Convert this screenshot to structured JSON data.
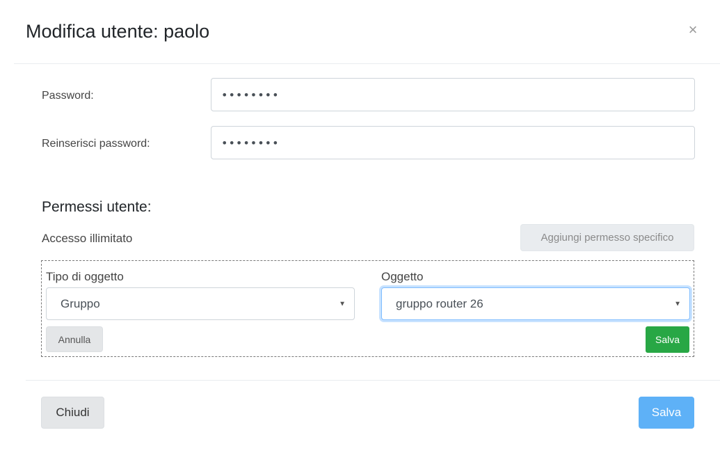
{
  "modal": {
    "title": "Modifica utente: paolo",
    "close_label": "×"
  },
  "form": {
    "password_label": "Password:",
    "password_value": "••••••••",
    "confirm_label": "Reinserisci password:",
    "confirm_value": "••••••••"
  },
  "permissions": {
    "title": "Permessi utente:",
    "access_text": "Accesso illimitato",
    "add_button": "Aggiungi permesso specifico",
    "object_type_label": "Tipo di oggetto",
    "object_type_value": "Gruppo",
    "object_label": "Oggetto",
    "object_value": "gruppo router 26",
    "cancel_button": "Annulla",
    "save_button": "Salva"
  },
  "footer": {
    "close_button": "Chiudi",
    "save_button": "Salva"
  },
  "colors": {
    "success": "#28a745",
    "primary": "#5eb1f7",
    "focus_border": "#80bdff"
  },
  "icons": {
    "close": "close-icon",
    "select_caret": "caret-down-icon"
  }
}
